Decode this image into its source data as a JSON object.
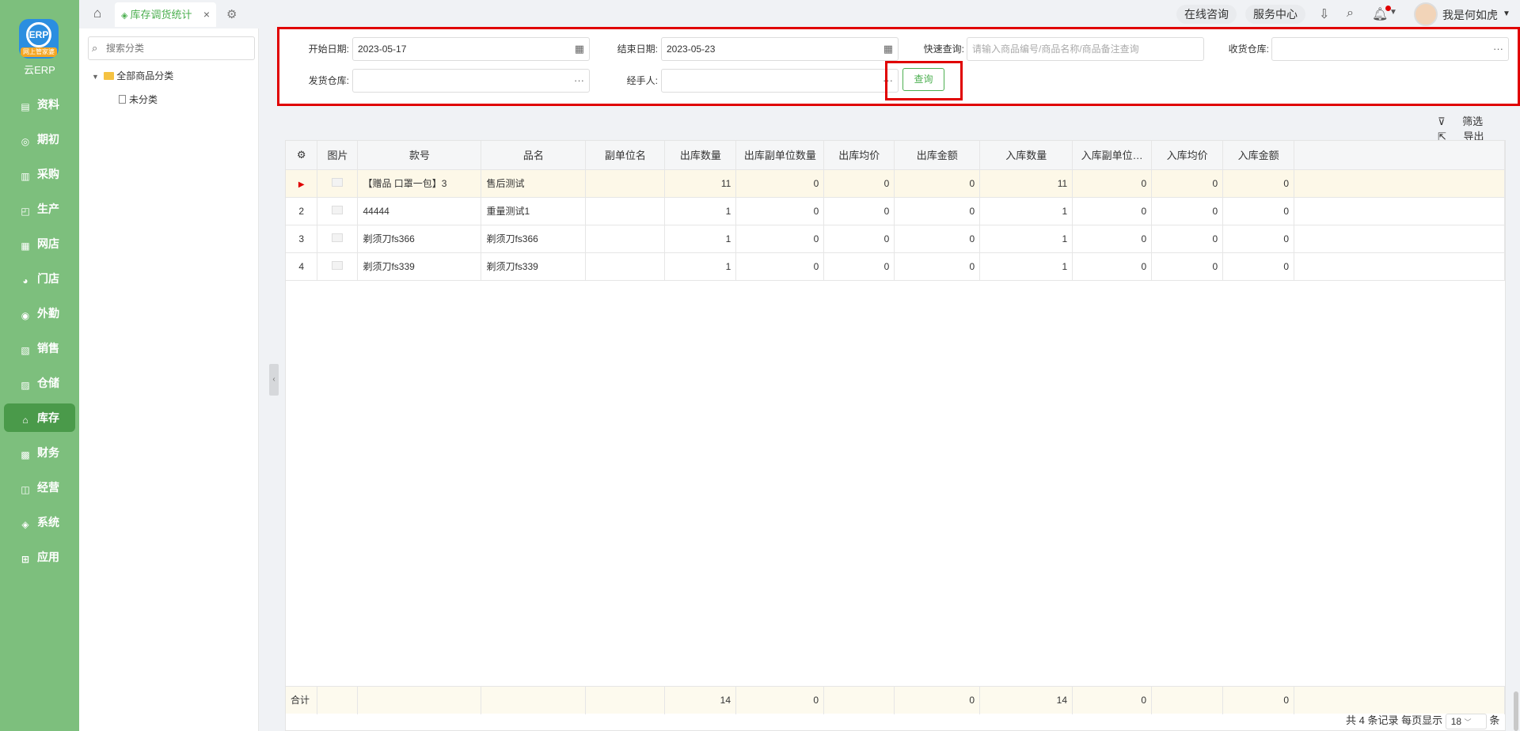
{
  "app": {
    "logo_text": "云ERP",
    "logo_mark": "ERP",
    "logo_ribbon": "网上管家婆"
  },
  "sidebar": {
    "items": [
      {
        "label": "资料",
        "icon": "file-icon"
      },
      {
        "label": "期初",
        "icon": "target-icon"
      },
      {
        "label": "采购",
        "icon": "purchase-icon"
      },
      {
        "label": "生产",
        "icon": "production-icon"
      },
      {
        "label": "网店",
        "icon": "shop-icon"
      },
      {
        "label": "门店",
        "icon": "store-icon"
      },
      {
        "label": "外勤",
        "icon": "field-icon"
      },
      {
        "label": "销售",
        "icon": "sales-icon"
      },
      {
        "label": "仓储",
        "icon": "warehouse-icon"
      },
      {
        "label": "库存",
        "icon": "inventory-icon"
      },
      {
        "label": "财务",
        "icon": "finance-icon"
      },
      {
        "label": "经营",
        "icon": "business-icon"
      },
      {
        "label": "系统",
        "icon": "system-icon"
      },
      {
        "label": "应用",
        "icon": "apps-icon"
      }
    ],
    "active_index": 9
  },
  "tabs": {
    "active_label": "库存调货统计"
  },
  "topbar": {
    "online_consult": "在线咨询",
    "service_center": "服务中心",
    "user_name": "我是何如虎"
  },
  "category": {
    "search_placeholder": "搜索分类",
    "root": "全部商品分类",
    "child": "未分类"
  },
  "filters": {
    "start_date_label": "开始日期:",
    "start_date_value": "2023-05-17",
    "end_date_label": "结束日期:",
    "end_date_value": "2023-05-23",
    "quick_search_label": "快速查询:",
    "quick_search_placeholder": "请输入商品编号/商品名称/商品备注查询",
    "receive_wh_label": "收货仓库:",
    "send_wh_label": "发货仓库:",
    "handler_label": "经手人:",
    "query_button": "查询"
  },
  "toolbar": {
    "filter": "筛选",
    "export": "导出"
  },
  "table": {
    "columns": [
      "图片",
      "款号",
      "品名",
      "副单位名",
      "出库数量",
      "出库副单位数量",
      "出库均价",
      "出库金额",
      "入库数量",
      "入库副单位…",
      "入库均价",
      "入库金额"
    ],
    "rows": [
      {
        "idx": "",
        "code": "【赠品 口罩一包】3",
        "name": "售后测试",
        "sub_unit": "",
        "out_qty": "11",
        "out_sub_qty": "0",
        "out_avg": "0",
        "out_amt": "0",
        "in_qty": "11",
        "in_sub_qty": "0",
        "in_avg": "0",
        "in_amt": "0"
      },
      {
        "idx": "2",
        "code": "44444",
        "name": "重量测试1",
        "sub_unit": "",
        "out_qty": "1",
        "out_sub_qty": "0",
        "out_avg": "0",
        "out_amt": "0",
        "in_qty": "1",
        "in_sub_qty": "0",
        "in_avg": "0",
        "in_amt": "0"
      },
      {
        "idx": "3",
        "code": "剃须刀fs366",
        "name": "剃须刀fs366",
        "sub_unit": "",
        "out_qty": "1",
        "out_sub_qty": "0",
        "out_avg": "0",
        "out_amt": "0",
        "in_qty": "1",
        "in_sub_qty": "0",
        "in_avg": "0",
        "in_amt": "0"
      },
      {
        "idx": "4",
        "code": "剃须刀fs339",
        "name": "剃须刀fs339",
        "sub_unit": "",
        "out_qty": "1",
        "out_sub_qty": "0",
        "out_avg": "0",
        "out_amt": "0",
        "in_qty": "1",
        "in_sub_qty": "0",
        "in_avg": "0",
        "in_amt": "0"
      }
    ],
    "footer": {
      "label": "合计",
      "out_qty": "14",
      "out_sub_qty": "0",
      "out_amt": "0",
      "in_qty": "14",
      "in_sub_qty": "0",
      "in_amt": "0"
    }
  },
  "pager": {
    "summary": "共 4 条记录",
    "per_page_label": "每页显示",
    "per_page_value": "18",
    "unit": "条"
  },
  "colors": {
    "sidebar": "#7dbf7d",
    "accent": "#4caf50",
    "highlight_border": "#e00000"
  }
}
